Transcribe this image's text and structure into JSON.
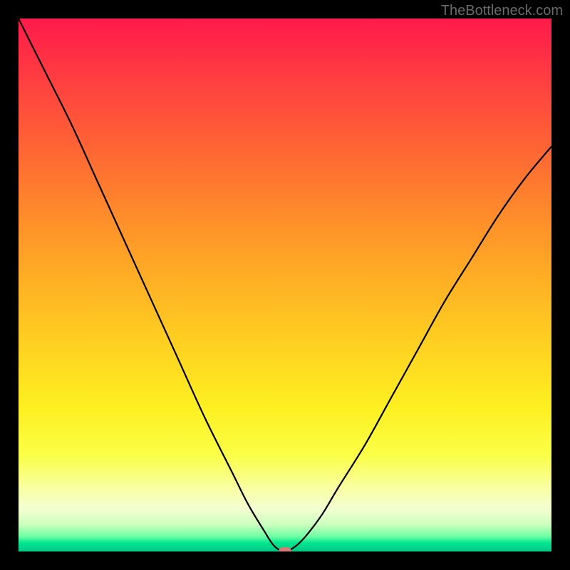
{
  "watermark": "TheBottleneck.com",
  "chart_data": {
    "type": "line",
    "title": "",
    "xlabel": "",
    "ylabel": "",
    "xlim": [
      0,
      100
    ],
    "ylim": [
      0,
      100
    ],
    "gradient_stops": [
      {
        "pos": 0,
        "color": "#ff1a4b"
      },
      {
        "pos": 12,
        "color": "#ff4040"
      },
      {
        "pos": 26,
        "color": "#ff6a33"
      },
      {
        "pos": 38,
        "color": "#ff8f2a"
      },
      {
        "pos": 50,
        "color": "#ffb224"
      },
      {
        "pos": 62,
        "color": "#ffd321"
      },
      {
        "pos": 73,
        "color": "#fdf021"
      },
      {
        "pos": 82,
        "color": "#fbff47"
      },
      {
        "pos": 88,
        "color": "#f9ffa1"
      },
      {
        "pos": 92,
        "color": "#f4ffd1"
      },
      {
        "pos": 95,
        "color": "#caffbe"
      },
      {
        "pos": 97.2,
        "color": "#6dffa3"
      },
      {
        "pos": 98.4,
        "color": "#00e58e"
      },
      {
        "pos": 100,
        "color": "#00c888"
      }
    ],
    "series": [
      {
        "name": "bottleneck-curve",
        "x": [
          0,
          5,
          10,
          15,
          20,
          25,
          30,
          35,
          40,
          43,
          46,
          48,
          50,
          52,
          54,
          57,
          60,
          65,
          70,
          75,
          80,
          85,
          90,
          95,
          100
        ],
        "y": [
          100,
          90,
          80,
          69,
          58,
          47,
          36,
          25,
          15,
          9,
          4,
          1,
          0,
          1,
          3,
          7,
          12,
          20,
          29,
          38,
          47,
          55,
          63,
          70,
          76
        ]
      }
    ],
    "marker": {
      "x": 50,
      "y": 0,
      "color": "#d97a75"
    }
  }
}
